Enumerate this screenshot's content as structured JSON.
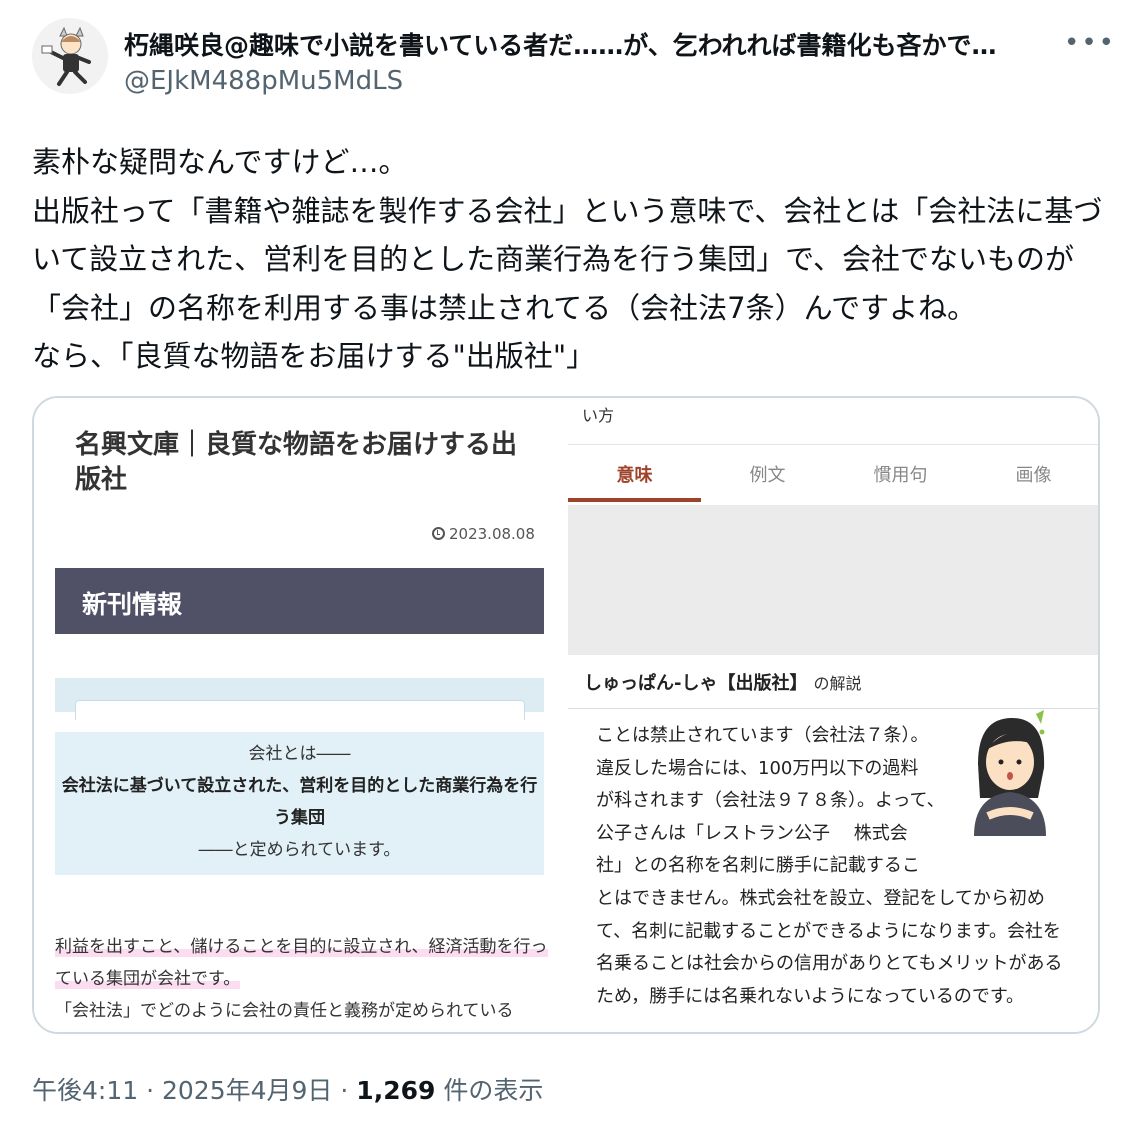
{
  "user": {
    "display_name": "朽縄咲良@趣味で小説を書いている者だ……が、乞われれば書籍化も吝かで…",
    "handle": "@EJkM488pMu5MdLS",
    "more_icon": "more-icon"
  },
  "tweet": {
    "lines": [
      "素朴な疑問なんですけど…。",
      "出版社って「書籍や雑誌を製作する会社」という意味で、会社とは「会社法に基づいて設立された、営利を目的とした商業行為を行う集団」で、会社でないものが「会社」の名称を利用する事は禁止されてる（会社法7条）んですよね。",
      "なら、「良質な物語をお届けする\"出版社\"」"
    ]
  },
  "left_image": {
    "title": "名興文庫｜良質な物語をお届けする出版社",
    "date": "2023.08.08",
    "section_heading": "新刊情報",
    "quote": {
      "line1": "会社とは――",
      "line2": "会社法に基づいて設立された、営利を目的とした商業行為を行う集団",
      "line3": "――と定められています。"
    },
    "text1": "利益を出すこと、儲けることを目的に設立され、経済活動を行っている集団が会社です。",
    "text2": "「会社法」でどのように会社の責任と義務が定められている"
  },
  "right_image": {
    "top_text": "い方",
    "tabs": [
      "意味",
      "例文",
      "慣用句",
      "画像"
    ],
    "active_tab": "意味",
    "entry_title": "しゅっぱん‐しゃ【出版社】",
    "entry_suffix": "の解説",
    "entry_lines_narrow": [
      "ことは禁止されています（会社法７条）。",
      "違反した場合には、100万円以下の過料",
      "が科されます（会社法９７８条）。よって、",
      "公子さんは「レストラン公子　 株式会",
      "社」との名称を名刺に勝手に記載するこ"
    ],
    "entry_rest": "とはできません。株式会社を設立、登記をしてから初めて、名刺に記載することができるようになります。会社を名乗ることは社会からの信用がありとてもメリットがあるため，勝手には名乗れないようになっているのです。"
  },
  "footer": {
    "time": "午後4:11",
    "date": "2025年4月9日",
    "views": "1,269",
    "views_label": "件の表示"
  }
}
